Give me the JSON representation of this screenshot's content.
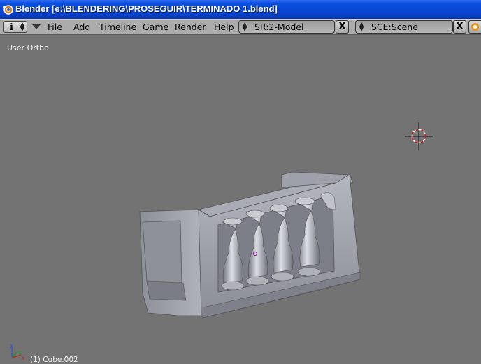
{
  "window": {
    "title": "Blender [e:\\BLENDERING\\PROSEGUIR\\TERMINADO 1.blend]"
  },
  "header": {
    "editor_type_icon": "i",
    "menus": [
      "File",
      "Add",
      "Timeline",
      "Game",
      "Render",
      "Help"
    ],
    "screen_field": "SR:2-Model",
    "scene_field": "SCE:Scene",
    "close_glyph": "X"
  },
  "viewport": {
    "view_label": "User Ortho",
    "object_label": "(1) Cube.002",
    "axis_labels": {
      "x": "x",
      "y": "y",
      "z": "z"
    }
  },
  "colors": {
    "background": "#737373",
    "header": "#acacac",
    "titlebar": "#0a46d2",
    "model": "#9a9ca6",
    "cursor": "#d02020"
  }
}
